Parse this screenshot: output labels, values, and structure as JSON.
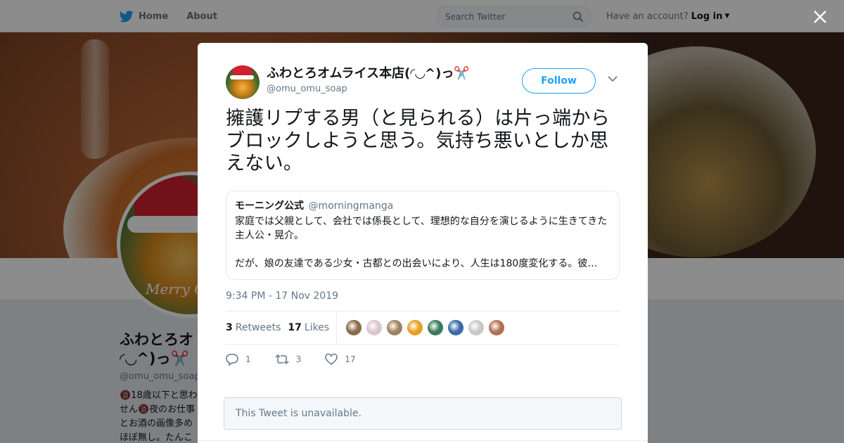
{
  "nav": {
    "home_label": "Home",
    "about_label": "About",
    "search_placeholder": "Search Twitter",
    "have_account": "Have an account?",
    "login_label": "Log in"
  },
  "profile": {
    "name_line1": "ふわとろオ",
    "name_line2": "◜◡^)っ✂️",
    "handle": "@omu_omu_soap",
    "bio_lines": [
      "🔞18歳以下と思わ",
      "せん🔞夜のお仕事",
      "とお酒の画像多め",
      "ほぼ無し。たんこ"
    ],
    "avatar_text": "Merry Ch"
  },
  "tweet": {
    "author_name": "ふわとろオムライス本店(◜◡^)っ✂️",
    "author_handle": "@omu_omu_soap",
    "follow_label": "Follow",
    "text": "擁護リプする男（と見られる）は片っ端からブロックしようと思う。気持ち悪いとしか思えない。",
    "quote": {
      "name": "モーニング公式",
      "handle": "@morningmanga",
      "body": "家庭では父親として、会社では係長として、理想的な自分を演じるように生きてきた主人公・晃介。\n\nだが、娘の友達である少女・古都との出会いにより、人生は180度変化する。彼…"
    },
    "timestamp": "9:34 PM - 17 Nov 2019",
    "retweets_count": "3",
    "retweets_label": "Retweets",
    "likes_count": "17",
    "likes_label": "Likes",
    "liker_colors": [
      "#8a6a4a",
      "#d9c7cf",
      "#a08060",
      "#e8a020",
      "#3a7a5a",
      "#3a6aa8",
      "#c8c8c8",
      "#b07050"
    ],
    "reply_count": "1",
    "retweet_action_count": "3",
    "like_action_count": "17"
  },
  "unavailable_notice": "This Tweet is unavailable.",
  "colors": {
    "twitter_blue": "#1da1f2",
    "muted_text": "#657786"
  }
}
